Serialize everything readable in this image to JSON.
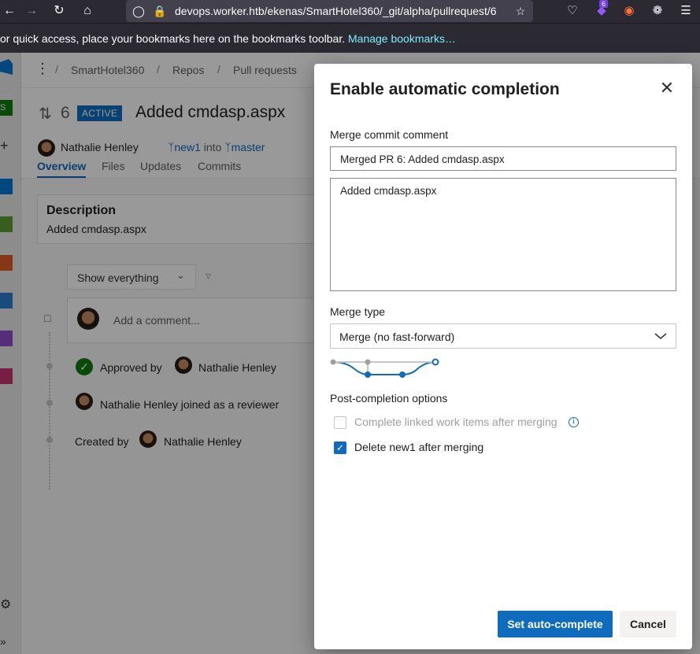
{
  "browser": {
    "url": "devops.worker.htb/ekenas/SmartHotel360/_git/alpha/pullrequest/6",
    "extension_badge": "6",
    "bookmarks_text": "or quick access, place your bookmarks here on the bookmarks toolbar.",
    "bookmarks_link": "Manage bookmarks…",
    "icons": [
      "back-icon",
      "forward-icon",
      "reload-icon",
      "home-icon",
      "shield-icon",
      "lock-icon",
      "star-icon",
      "pocket-icon",
      "extension-icon",
      "firefox-icon",
      "cookie-icon",
      "menu-icon"
    ]
  },
  "breadcrumb": {
    "items": [
      "SmartHotel360",
      "Repos",
      "Pull requests"
    ],
    "separator": "/"
  },
  "pr": {
    "number": "6",
    "status": "ACTIVE",
    "title": "Added cmdasp.aspx",
    "author": "Nathalie Henley",
    "source_branch": "new1",
    "into": "into",
    "target_branch": "master",
    "tabs": [
      "Overview",
      "Files",
      "Updates",
      "Commits"
    ],
    "selected_tab": "Overview"
  },
  "overview": {
    "description_heading": "Description",
    "description_body": "Added cmdasp.aspx",
    "filter_label": "Show everything",
    "comment_placeholder": "Add a comment...",
    "timeline": {
      "approved_prefix": "Approved by",
      "approved_user": "Nathalie Henley",
      "joined": "Nathalie Henley joined as a reviewer",
      "created_prefix": "Created by",
      "created_user": "Nathalie Henley"
    }
  },
  "dialog": {
    "title": "Enable automatic completion",
    "merge_comment_label": "Merge commit comment",
    "merge_comment_value": "Merged PR 6: Added cmdasp.aspx",
    "merge_comment_body": "Added cmdasp.aspx",
    "merge_type_label": "Merge type",
    "merge_type_value": "Merge (no fast-forward)",
    "post_completion_label": "Post-completion options",
    "option_complete_work_items": "Complete linked work items after merging",
    "option_complete_work_items_checked": false,
    "option_complete_work_items_disabled": true,
    "option_delete_branch": "Delete new1 after merging",
    "option_delete_branch_checked": true,
    "primary_button": "Set auto-complete",
    "cancel_button": "Cancel",
    "accent_color": "#0f6cbd"
  }
}
